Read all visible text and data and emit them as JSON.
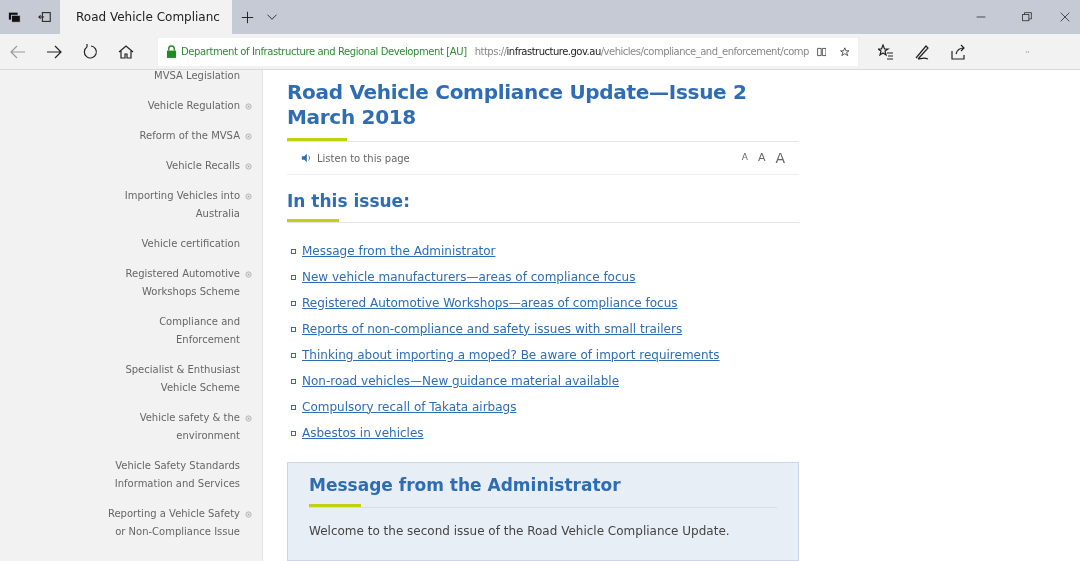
{
  "browser": {
    "tab": {
      "title": "Road Vehicle Complianc",
      "selected": true
    },
    "address_bar": {
      "site_identity": "Department of Infrastructure and Regional Development [AU]",
      "url_prefix": "https://",
      "url_host": "infrastructure.gov.au",
      "url_path": "/vehicles/compliance_and_enforcement/comp"
    }
  },
  "sidebar": {
    "items": [
      {
        "label": "MVSA Legislation",
        "expandable": false
      },
      {
        "label": "Vehicle Regulation",
        "expandable": true
      },
      {
        "label": "Reform of the MVSA",
        "expandable": true
      },
      {
        "label": "Vehicle Recalls",
        "expandable": true
      },
      {
        "label": "Importing Vehicles into Australia",
        "expandable": true
      },
      {
        "label": "Vehicle certification",
        "expandable": false
      },
      {
        "label": "Registered Automotive Workshops Scheme",
        "expandable": true
      },
      {
        "label": "Compliance and Enforcement",
        "expandable": false
      },
      {
        "label": "Specialist & Enthusiast Vehicle Scheme",
        "expandable": false
      },
      {
        "label": "Vehicle safety & the environment",
        "expandable": true
      },
      {
        "label": "Vehicle Safety Standards Information and Services",
        "expandable": false
      },
      {
        "label": "Reporting a Vehicle Safety or Non-Compliance Issue",
        "expandable": true
      }
    ]
  },
  "article": {
    "title_lines": [
      "Road Vehicle Compliance Update—Issue 2",
      "March 2018"
    ],
    "listen": "Listen to this page",
    "text_sizes": [
      "A",
      "A",
      "A"
    ],
    "section_heading": "In this issue:",
    "links": [
      "Message from the Administrator",
      "New vehicle manufacturers—areas of compliance focus",
      "Registered Automotive Workshops—areas of compliance focus",
      "Reports of non-compliance and safety issues with small trailers",
      "Thinking about importing a moped? Be aware of import requirements",
      "Non-road vehicles—New guidance material available",
      "Compulsory recall of Takata airbags",
      "Asbestos in vehicles"
    ],
    "message_box": {
      "heading": "Message from the Administrator",
      "text": "Welcome to the second issue of the Road Vehicle Compliance Update."
    }
  }
}
